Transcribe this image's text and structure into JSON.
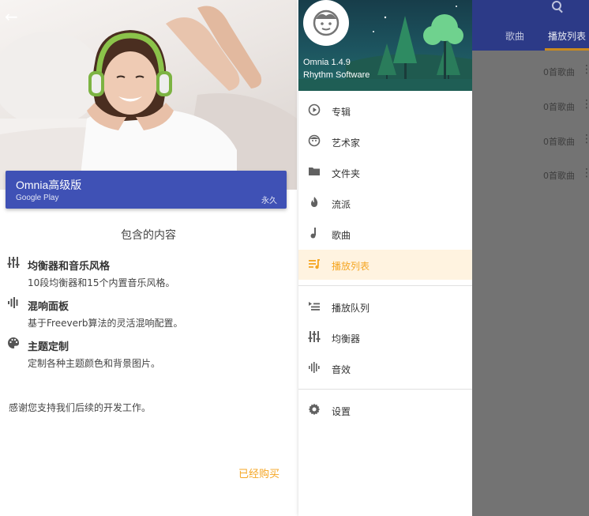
{
  "left": {
    "purchase_card": {
      "title": "Omnia高级版",
      "subtitle": "Google Play",
      "term": "永久",
      "color": "#3f51b5"
    },
    "included_heading": "包含的内容",
    "features": [
      {
        "icon": "equalizer-icon",
        "title": "均衡器和音乐风格",
        "desc": "10段均衡器和15个内置音乐风格。"
      },
      {
        "icon": "waveform-icon",
        "title": "混响面板",
        "desc": "基于Freeverb算法的灵活混响配置。"
      },
      {
        "icon": "palette-icon",
        "title": "主题定制",
        "desc": "定制各种主题颜色和背景图片。"
      }
    ],
    "thanks": "感谢您支持我们后续的开发工作。",
    "bought_label": "已经购买",
    "accent": "#f5a623"
  },
  "drawer": {
    "app_version": "Omnia 1.4.9",
    "company": "Rhythm Software",
    "menu": [
      {
        "icon": "album-icon",
        "label": "专辑"
      },
      {
        "icon": "artist-icon",
        "label": "艺术家"
      },
      {
        "icon": "folder-icon",
        "label": "文件夹"
      },
      {
        "icon": "genre-icon",
        "label": "流派"
      },
      {
        "icon": "music-note-icon",
        "label": "歌曲"
      },
      {
        "icon": "playlist-icon",
        "label": "播放列表",
        "active": true
      }
    ],
    "menu2": [
      {
        "icon": "queue-icon",
        "label": "播放队列"
      },
      {
        "icon": "equalizer-icon",
        "label": "均衡器"
      },
      {
        "icon": "waveform-icon",
        "label": "音效"
      }
    ],
    "settings_label": "设置"
  },
  "right": {
    "tabs": [
      "歌曲",
      "播放列表"
    ],
    "rows": [
      "0首歌曲",
      "0首歌曲",
      "0首歌曲",
      "0首歌曲"
    ]
  }
}
